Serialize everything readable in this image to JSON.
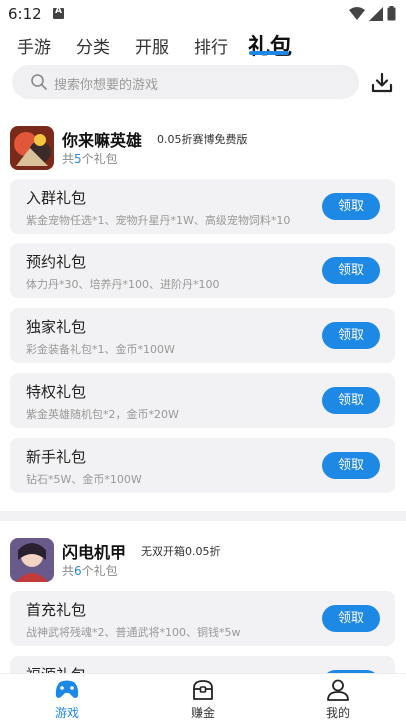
{
  "status_bar": {
    "time": "6:12"
  },
  "tabs": [
    {
      "label": "手游"
    },
    {
      "label": "分类"
    },
    {
      "label": "开服"
    },
    {
      "label": "排行"
    },
    {
      "label": "礼包"
    }
  ],
  "search": {
    "placeholder": "搜索你想要的游戏"
  },
  "games": [
    {
      "name": "你来嘛英雄",
      "tag": "0.05折赛博免费版",
      "count_prefix": "共",
      "count": "5",
      "count_suffix": "个礼包",
      "gifts": [
        {
          "title": "入群礼包",
          "desc": "紫金宠物任选*1、宠物升星丹*1W、高级宠物饲料*10",
          "button": "领取"
        },
        {
          "title": "预约礼包",
          "desc": "体力丹*30、培养丹*100、进阶丹*100",
          "button": "领取"
        },
        {
          "title": "独家礼包",
          "desc": "彩金装备礼包*1、金币*100W",
          "button": "领取"
        },
        {
          "title": "特权礼包",
          "desc": "紫金英雄随机包*2，金币*20W",
          "button": "领取"
        },
        {
          "title": "新手礼包",
          "desc": "钻石*5W、金币*100W",
          "button": "领取"
        }
      ]
    },
    {
      "name": "闪电机甲",
      "tag": "无双开箱0.05折",
      "count_prefix": "共",
      "count": "6",
      "count_suffix": "个礼包",
      "gifts": [
        {
          "title": "首充礼包",
          "desc": "战神武将残魂*2、普通武将*100、铜钱*5w",
          "button": "领取"
        },
        {
          "title": "福源礼包",
          "desc": "",
          "button": "领取"
        }
      ]
    }
  ],
  "bottom_nav": [
    {
      "label": "游戏"
    },
    {
      "label": "赚金"
    },
    {
      "label": "我的"
    }
  ],
  "colors": {
    "accent": "#1e88e5",
    "card_bg": "#f2f2f4"
  }
}
